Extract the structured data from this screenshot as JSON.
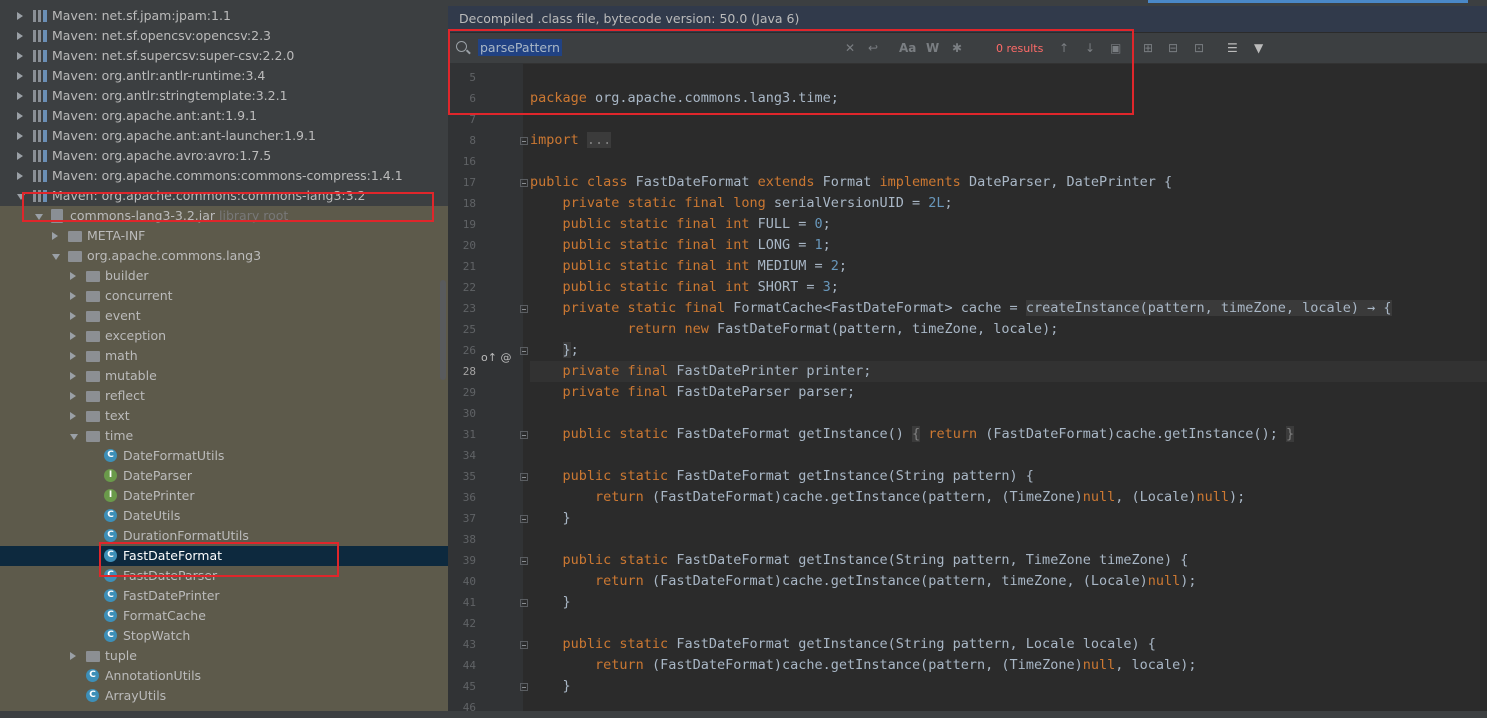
{
  "tree": {
    "items": [
      {
        "label": "Maven: net.sf.jpam:jpam:1.1",
        "icon": "library-icon",
        "expanded": false,
        "depth": 0
      },
      {
        "label": "Maven: net.sf.opencsv:opencsv:2.3",
        "icon": "library-icon",
        "expanded": false,
        "depth": 0
      },
      {
        "label": "Maven: net.sf.supercsv:super-csv:2.2.0",
        "icon": "library-icon",
        "expanded": false,
        "depth": 0
      },
      {
        "label": "Maven: org.antlr:antlr-runtime:3.4",
        "icon": "library-icon",
        "expanded": false,
        "depth": 0
      },
      {
        "label": "Maven: org.antlr:stringtemplate:3.2.1",
        "icon": "library-icon",
        "expanded": false,
        "depth": 0
      },
      {
        "label": "Maven: org.apache.ant:ant:1.9.1",
        "icon": "library-icon",
        "expanded": false,
        "depth": 0
      },
      {
        "label": "Maven: org.apache.ant:ant-launcher:1.9.1",
        "icon": "library-icon",
        "expanded": false,
        "depth": 0
      },
      {
        "label": "Maven: org.apache.avro:avro:1.7.5",
        "icon": "library-icon",
        "expanded": false,
        "depth": 0
      },
      {
        "label": "Maven: org.apache.commons:commons-compress:1.4.1",
        "icon": "library-icon",
        "expanded": false,
        "depth": 0
      },
      {
        "label": "Maven: org.apache.commons:commons-lang3:3.2",
        "icon": "library-icon",
        "expanded": true,
        "depth": 0
      },
      {
        "label": "commons-lang3-3.2.jar",
        "suffix": "library root",
        "icon": "jar-icon",
        "expanded": true,
        "depth": 1
      },
      {
        "label": "META-INF",
        "icon": "folder-icon",
        "expanded": false,
        "depth": 2
      },
      {
        "label": "org.apache.commons.lang3",
        "icon": "package-icon",
        "expanded": true,
        "depth": 2
      },
      {
        "label": "builder",
        "icon": "package-icon",
        "expanded": false,
        "depth": 3
      },
      {
        "label": "concurrent",
        "icon": "package-icon",
        "expanded": false,
        "depth": 3
      },
      {
        "label": "event",
        "icon": "package-icon",
        "expanded": false,
        "depth": 3
      },
      {
        "label": "exception",
        "icon": "package-icon",
        "expanded": false,
        "depth": 3
      },
      {
        "label": "math",
        "icon": "package-icon",
        "expanded": false,
        "depth": 3
      },
      {
        "label": "mutable",
        "icon": "package-icon",
        "expanded": false,
        "depth": 3
      },
      {
        "label": "reflect",
        "icon": "package-icon",
        "expanded": false,
        "depth": 3
      },
      {
        "label": "text",
        "icon": "package-icon",
        "expanded": false,
        "depth": 3
      },
      {
        "label": "time",
        "icon": "package-icon",
        "expanded": true,
        "depth": 3
      },
      {
        "label": "DateFormatUtils",
        "icon": "class-icon",
        "depth": 4
      },
      {
        "label": "DateParser",
        "icon": "interface-icon",
        "depth": 4
      },
      {
        "label": "DatePrinter",
        "icon": "interface-icon",
        "depth": 4
      },
      {
        "label": "DateUtils",
        "icon": "class-icon",
        "depth": 4
      },
      {
        "label": "DurationFormatUtils",
        "icon": "class-icon",
        "depth": 4
      },
      {
        "label": "FastDateFormat",
        "icon": "class-icon",
        "depth": 4,
        "selected": true
      },
      {
        "label": "FastDateParser",
        "icon": "class-icon",
        "depth": 4
      },
      {
        "label": "FastDatePrinter",
        "icon": "class-icon",
        "depth": 4
      },
      {
        "label": "FormatCache",
        "icon": "class-icon",
        "depth": 4
      },
      {
        "label": "StopWatch",
        "icon": "class-icon",
        "depth": 4
      },
      {
        "label": "tuple",
        "icon": "package-icon",
        "expanded": false,
        "depth": 3
      },
      {
        "label": "AnnotationUtils",
        "icon": "class-icon",
        "depth": 3
      },
      {
        "label": "ArrayUtils",
        "icon": "class-icon",
        "depth": 3
      }
    ]
  },
  "editor": {
    "banner": "Decompiled .class file, bytecode version: 50.0 (Java 6)",
    "find": {
      "query": "parsePattern",
      "results": "0 results",
      "icons": [
        "clear-icon",
        "history-icon",
        "match-case-icon",
        "whole-words-icon",
        "regex-icon",
        "prev-occurrence-icon",
        "next-occurrence-icon",
        "open-in-window-icon",
        "add-selection-icon",
        "remove-selection-icon",
        "select-all-icon",
        "multiline-icon",
        "filter-icon"
      ]
    },
    "lines": [
      {
        "n": "5",
        "html": ""
      },
      {
        "n": "6",
        "html": "<span class=\"kw\">package</span> org.apache.commons.lang3.time;"
      },
      {
        "n": "7",
        "html": ""
      },
      {
        "n": "8",
        "html": "<span class=\"kw\">import</span> <span class=\"fold-txt\">...</span>"
      },
      {
        "n": "16",
        "html": ""
      },
      {
        "n": "17",
        "html": "<span class=\"kw\">public class</span> FastDateFormat <span class=\"kw\">extends</span> Format <span class=\"kw\">implements</span> DateParser, DatePrinter {"
      },
      {
        "n": "18",
        "html": "    <span class=\"kw\">private static final long</span> serialVersionUID = <span class=\"num\">2L</span>;"
      },
      {
        "n": "19",
        "html": "    <span class=\"kw\">public static final int</span> FULL = <span class=\"num\">0</span>;"
      },
      {
        "n": "20",
        "html": "    <span class=\"kw\">public static final int</span> LONG = <span class=\"num\">1</span>;"
      },
      {
        "n": "21",
        "html": "    <span class=\"kw\">public static final int</span> MEDIUM = <span class=\"num\">2</span>;"
      },
      {
        "n": "22",
        "html": "    <span class=\"kw\">public static final int</span> SHORT = <span class=\"num\">3</span>;"
      },
      {
        "n": "23",
        "html": "    <span class=\"kw\">private static final</span> FormatCache&lt;FastDateFormat&gt; cache = <span class=\"lambda\">createInstance(pattern, timeZone, locale) → {</span>"
      },
      {
        "n": "25",
        "html": "            <span class=\"kw\">return new</span> FastDateFormat(pattern, timeZone, locale);"
      },
      {
        "n": "26",
        "html": "    <span class=\"lambda\">}</span>;"
      },
      {
        "n": "28",
        "html": "    <span class=\"kw\">private final</span> FastDatePrinter printer;",
        "cur": true
      },
      {
        "n": "29",
        "html": "    <span class=\"kw\">private final</span> FastDateParser parser;"
      },
      {
        "n": "30",
        "html": ""
      },
      {
        "n": "31",
        "html": "    <span class=\"kw\">public static</span> FastDateFormat getInstance() <span class=\"fold-txt\">{</span> <span class=\"kw\">return</span> (FastDateFormat)cache.getInstance(); <span class=\"fold-txt\">}</span>"
      },
      {
        "n": "34",
        "html": ""
      },
      {
        "n": "35",
        "html": "    <span class=\"kw\">public static</span> FastDateFormat getInstance(String pattern) {"
      },
      {
        "n": "36",
        "html": "        <span class=\"kw\">return</span> (FastDateFormat)cache.getInstance(pattern, (TimeZone)<span class=\"kw\">null</span>, (Locale)<span class=\"kw\">null</span>);"
      },
      {
        "n": "37",
        "html": "    }"
      },
      {
        "n": "38",
        "html": ""
      },
      {
        "n": "39",
        "html": "    <span class=\"kw\">public static</span> FastDateFormat getInstance(String pattern, TimeZone timeZone) {"
      },
      {
        "n": "40",
        "html": "        <span class=\"kw\">return</span> (FastDateFormat)cache.getInstance(pattern, timeZone, (Locale)<span class=\"kw\">null</span>);"
      },
      {
        "n": "41",
        "html": "    }"
      },
      {
        "n": "42",
        "html": ""
      },
      {
        "n": "43",
        "html": "    <span class=\"kw\">public static</span> FastDateFormat getInstance(String pattern, Locale locale) {"
      },
      {
        "n": "44",
        "html": "        <span class=\"kw\">return</span> (FastDateFormat)cache.getInstance(pattern, (TimeZone)<span class=\"kw\">null</span>, locale);"
      },
      {
        "n": "45",
        "html": "    }"
      },
      {
        "n": "46",
        "html": ""
      }
    ],
    "gutter_marks": "o↑ @"
  },
  "colors": {
    "highlight_box": "#e0262b",
    "selection": "#0d293e",
    "keyword": "#cc7832",
    "number": "#6897bb"
  }
}
